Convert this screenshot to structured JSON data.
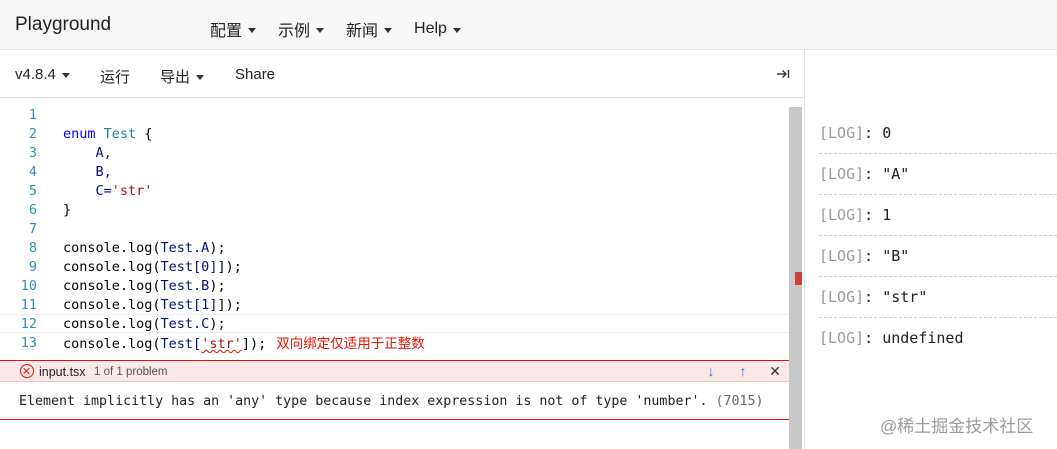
{
  "header": {
    "brand": "Playground",
    "menus": [
      {
        "label": "配置"
      },
      {
        "label": "示例"
      },
      {
        "label": "新闻"
      },
      {
        "label": "Help"
      }
    ]
  },
  "toolbar": {
    "version": "v4.8.4",
    "run": "运行",
    "export": "导出",
    "share": "Share",
    "collapse_icon": "collapse-right-icon"
  },
  "editor": {
    "line_numbers": [
      "1",
      "2",
      "3",
      "4",
      "5",
      "6",
      "7",
      "8",
      "9",
      "10",
      "11",
      "12",
      "13"
    ],
    "lines": {
      "l2_kw": "enum",
      "l2_name": "Test",
      "l2_brace": " {",
      "l3": "    A,",
      "l4": "    B,",
      "l5_a": "    C=",
      "l5_b": "'str'",
      "l6": "}",
      "l8_a": "console.log(",
      "l8_b": "Test.A",
      "l8_c": ");",
      "l9_a": "console.log(",
      "l9_b": "Test[0]",
      "l9_c": "]);",
      "l10_a": "console.log(",
      "l10_b": "Test.B",
      "l10_c": ");",
      "l11_a": "console.log(",
      "l11_b": "Test[1]",
      "l11_c": "]);",
      "l12_a": "console.log(",
      "l12_b": "Test.C",
      "l12_c": ");",
      "l13_a": "console.log(",
      "l13_b": "Test[",
      "l13_str": "'str'",
      "l13_c": "]);",
      "l13_msg": "双向绑定仅适用于正整数"
    }
  },
  "problem": {
    "file": "input.tsx",
    "count": "1 of 1 problem",
    "message": "Element implicitly has an 'any' type because index expression is not of type 'number'.",
    "code": "(7015)",
    "next_icon": "arrow-down-icon",
    "prev_icon": "arrow-up-icon",
    "close_icon": "close-icon"
  },
  "console": {
    "tag": "LOG",
    "entries": [
      "0",
      "\"A\"",
      "1",
      "\"B\"",
      "\"str\"",
      "undefined"
    ]
  },
  "watermark": "@稀土掘金技术社区",
  "colors": {
    "keyword": "#0000ff",
    "string": "#a31515",
    "error": "#e51400",
    "line_number": "#2b91af"
  }
}
